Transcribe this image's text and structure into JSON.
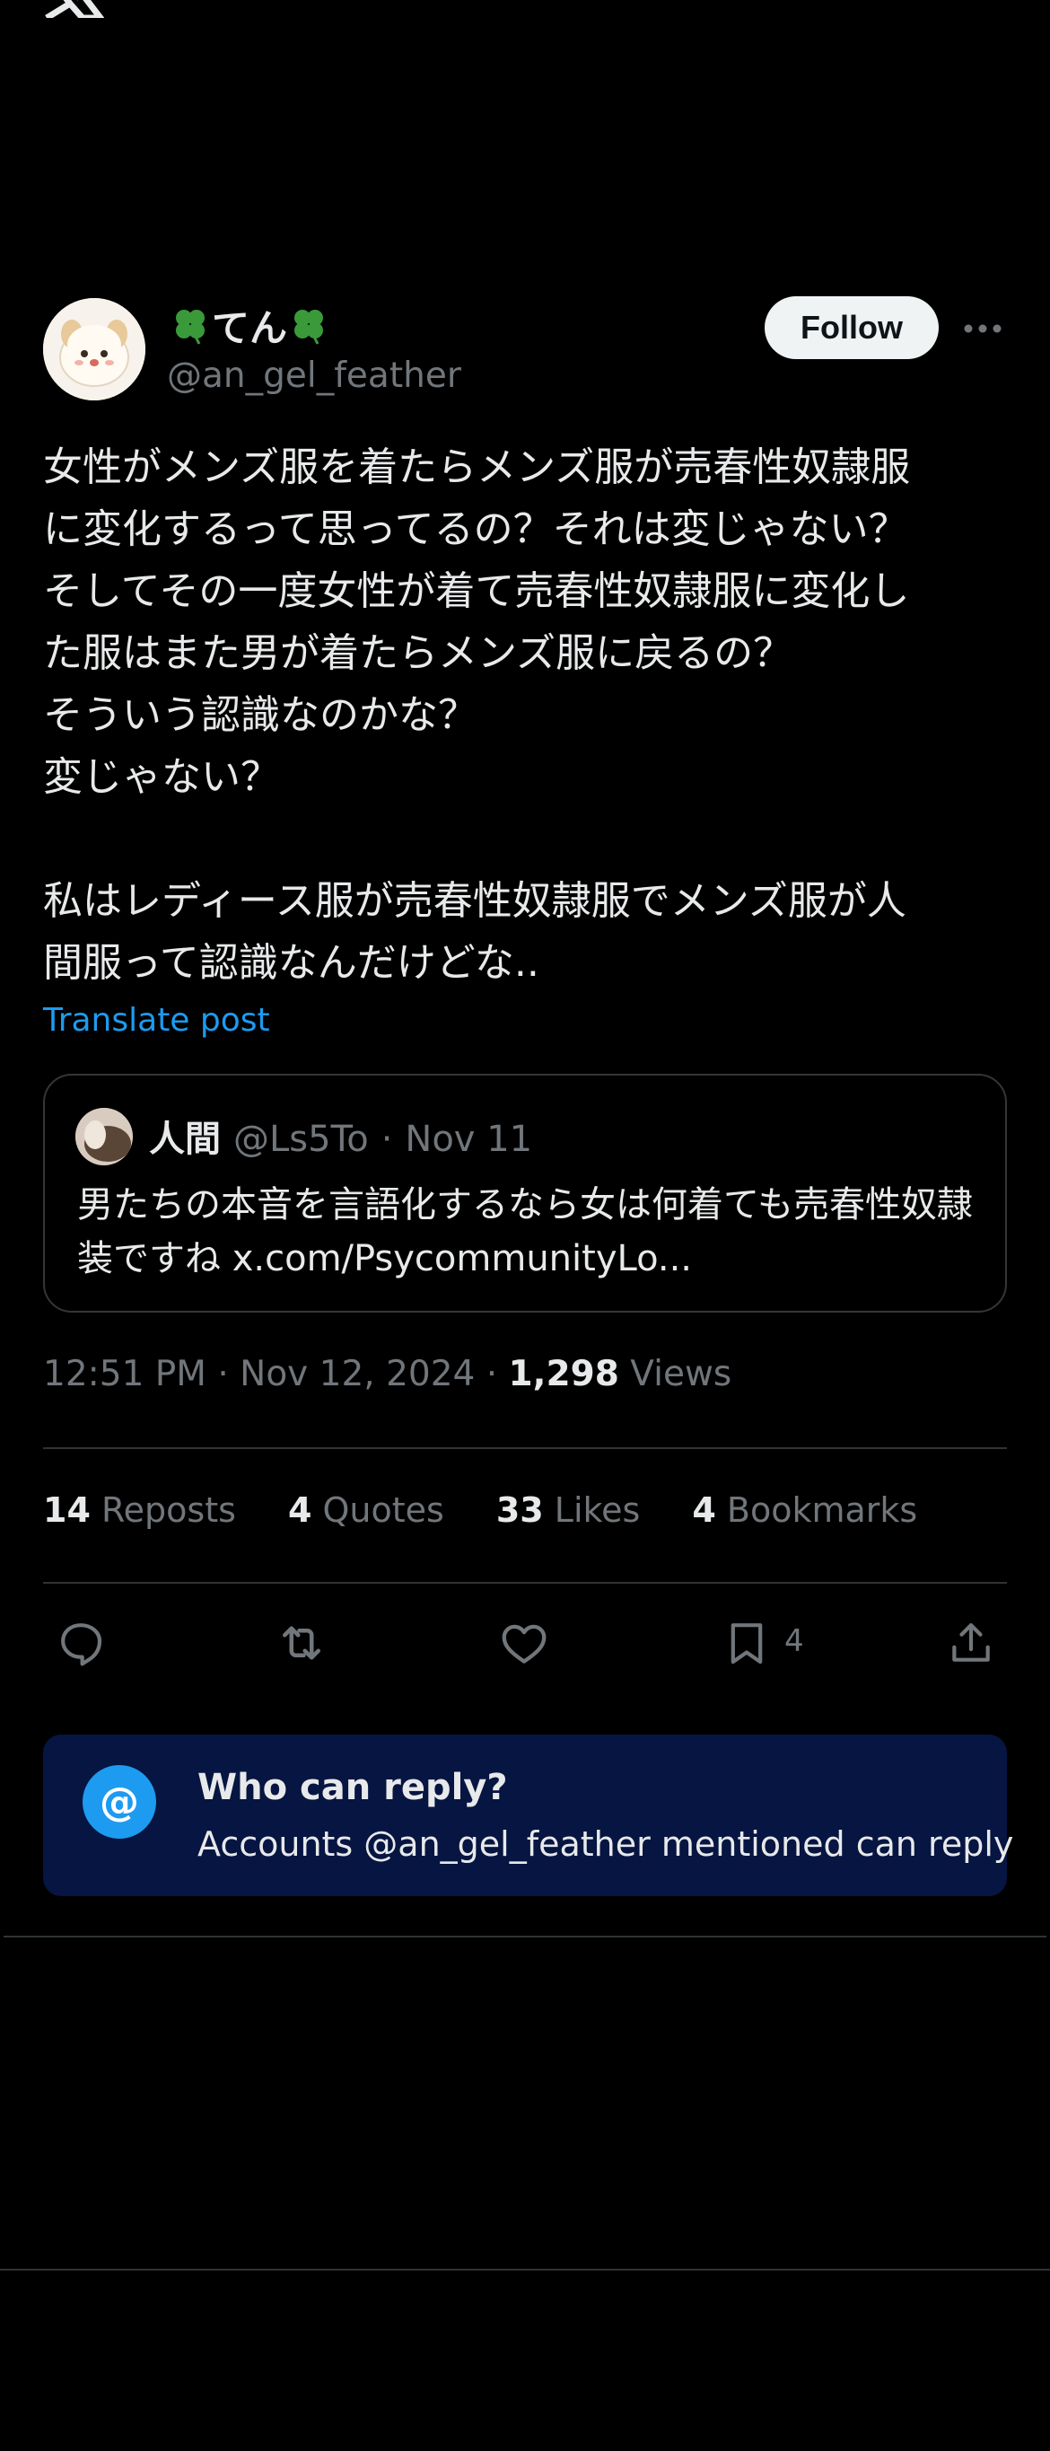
{
  "author": {
    "display_name": "てん",
    "handle": "@an_gel_feather",
    "follow_label": "Follow"
  },
  "post": {
    "text": "女性がメンズ服を着たらメンズ服が売春性奴隷服\nに変化するって思ってるの？それは変じゃない？\nそしてその一度女性が着て売春性奴隷服に変化し\nた服はまた男が着たらメンズ服に戻るの？\nそういう認識なのかな？\n変じゃない？\n\n私はレディース服が売春性奴隷服でメンズ服が人\n間服って認識なんだけどな..",
    "translate_label": "Translate post"
  },
  "quote": {
    "name": "人間",
    "handle": "@Ls5To",
    "separator": "·",
    "date": "Nov 11",
    "text": "男たちの本音を言語化するなら女は何着ても売春性奴隷装ですね x.com/PsycommunityLo..."
  },
  "meta": {
    "timestamp": "12:51 PM · Nov 12, 2024 · ",
    "views_count": "1,298",
    "views_label": " Views"
  },
  "stats": {
    "reposts_count": "14",
    "reposts_label": "Reposts",
    "quotes_count": "4",
    "quotes_label": "Quotes",
    "likes_count": "33",
    "likes_label": "Likes",
    "bookmarks_count": "4",
    "bookmarks_label": "Bookmarks"
  },
  "actions": {
    "bookmark_count": "4"
  },
  "reply_settings": {
    "icon_text": "@",
    "title": "Who can reply?",
    "subtitle": "Accounts @an_gel_feather mentioned can reply"
  },
  "icons": [
    "x-logo-icon",
    "clover-icon",
    "more-icon",
    "reply-icon",
    "repost-icon",
    "like-icon",
    "bookmark-icon",
    "share-icon"
  ],
  "colors": {
    "background": "#000000",
    "accent": "#1d9bf0",
    "muted": "#71767b",
    "reply_box": "#061541"
  }
}
